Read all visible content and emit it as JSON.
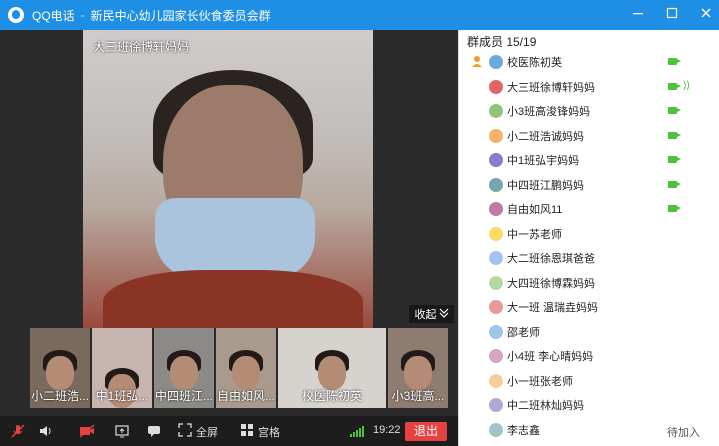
{
  "window": {
    "app_name": "QQ电话",
    "title": "新民中心幼儿园家长伙食委员会群"
  },
  "main_video": {
    "speaker": "大三班徐博轩妈妈",
    "collapse_label": "收起"
  },
  "thumbnails": [
    {
      "label": "小二班浩..."
    },
    {
      "label": "中1班弘..."
    },
    {
      "label": "中四班江..."
    },
    {
      "label": "自由如风..."
    },
    {
      "label": "校医陈初英"
    },
    {
      "label": "小3班高..."
    }
  ],
  "toolbar": {
    "fullscreen_label": "全屏",
    "grid_label": "宫格",
    "time": "19:22",
    "exit_label": "退出"
  },
  "members_panel": {
    "title": "群成员 15/19",
    "members": [
      {
        "name": "校医陈初英",
        "camera": true,
        "speaking": false,
        "pending": ""
      },
      {
        "name": "大三班徐博轩妈妈",
        "camera": true,
        "speaking": true,
        "pending": ""
      },
      {
        "name": "小3班高浚锋妈妈",
        "camera": true,
        "speaking": false,
        "pending": ""
      },
      {
        "name": "小二班浩诚妈妈",
        "camera": true,
        "speaking": false,
        "pending": ""
      },
      {
        "name": "中1班弘宇妈妈",
        "camera": true,
        "speaking": false,
        "pending": ""
      },
      {
        "name": "中四班江鹏妈妈",
        "camera": true,
        "speaking": false,
        "pending": ""
      },
      {
        "name": "自由如风11",
        "camera": true,
        "speaking": false,
        "pending": ""
      },
      {
        "name": "中一苏老师",
        "camera": false,
        "speaking": false,
        "pending": ""
      },
      {
        "name": "大二班徐恩琪爸爸",
        "camera": false,
        "speaking": false,
        "pending": ""
      },
      {
        "name": "大四班徐博霖妈妈",
        "camera": false,
        "speaking": false,
        "pending": ""
      },
      {
        "name": "大一班 温瑞垚妈妈",
        "camera": false,
        "speaking": false,
        "pending": ""
      },
      {
        "name": "邵老师",
        "camera": false,
        "speaking": false,
        "pending": ""
      },
      {
        "name": "小4班 李心晴妈妈",
        "camera": false,
        "speaking": false,
        "pending": ""
      },
      {
        "name": "小一班张老师",
        "camera": false,
        "speaking": false,
        "pending": ""
      },
      {
        "name": "中二班林灿妈妈",
        "camera": false,
        "speaking": false,
        "pending": ""
      },
      {
        "name": "李志鑫",
        "camera": false,
        "speaking": false,
        "pending": "待加入"
      }
    ]
  },
  "colors": {
    "titlebar": "#1f8fe6",
    "camera_on": "#4cc33a",
    "exit_button": "#e64242"
  }
}
